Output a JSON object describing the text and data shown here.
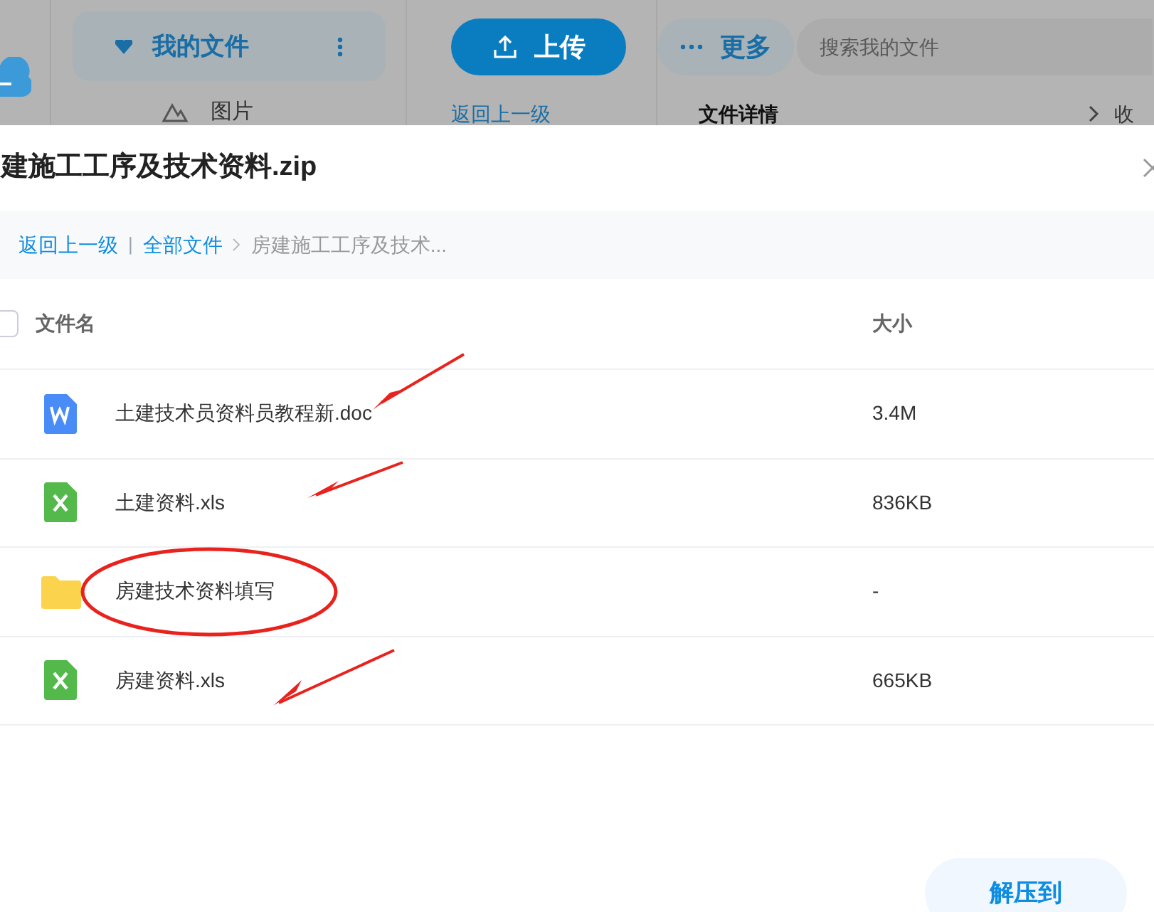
{
  "background": {
    "my_files": "我的文件",
    "upload": "上传",
    "more": "更多",
    "search": {
      "placeholder": "搜索我的文件"
    },
    "nav_item": "图片",
    "back": "返回上一级",
    "details": "文件详情",
    "collapse": "收"
  },
  "dialog": {
    "title": "建施工工序及技术资料.zip",
    "breadcrumb": {
      "back": "返回上一级",
      "separator": "|",
      "root": "全部文件",
      "current": "房建施工工序及技术..."
    },
    "table": {
      "columns": [
        "文件名",
        "大小"
      ],
      "checked": false,
      "rows": [
        {
          "kind": "doc",
          "name": "土建技术员资料员教程新.doc",
          "size": "3.4M"
        },
        {
          "kind": "xls",
          "name": "土建资料.xls",
          "size": "836KB"
        },
        {
          "kind": "folder",
          "name": "房建技术资料填写",
          "size": "-"
        },
        {
          "kind": "xls",
          "name": "房建资料.xls",
          "size": "665KB"
        }
      ]
    },
    "extract": "解压到"
  }
}
